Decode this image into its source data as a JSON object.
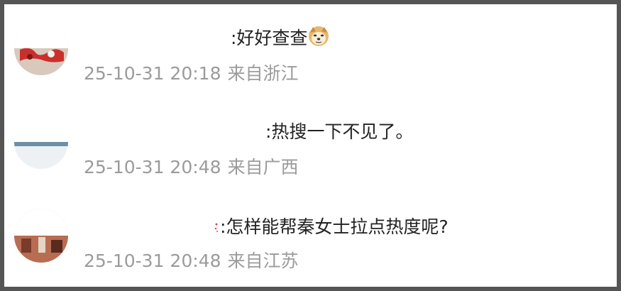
{
  "comments": [
    {
      "text": ":好好查查",
      "emoji": "doge-icon",
      "timestamp": "25-10-31 20:18",
      "location": "来自浙江"
    },
    {
      "text": ":热搜一下不见了。",
      "timestamp": "25-10-31 20:48",
      "location": "来自广西"
    },
    {
      "text": ":怎样能帮秦女士拉点热度呢?",
      "timestamp": "25-10-31 20:48",
      "location": "来自江苏"
    }
  ],
  "colors": {
    "frame": "#555555",
    "text": "#222222",
    "meta": "#9b9b9b"
  }
}
